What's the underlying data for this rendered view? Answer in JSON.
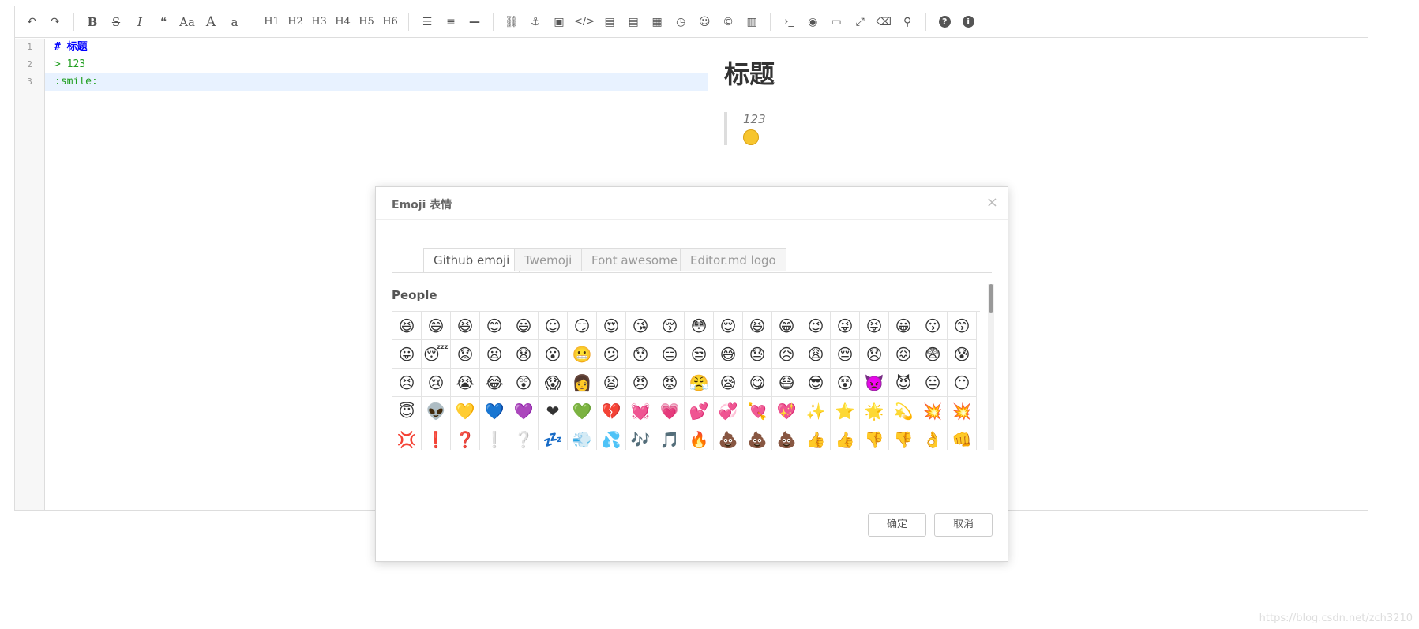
{
  "toolbar": {
    "undo_icon": "undo-icon",
    "redo_icon": "redo-icon",
    "bold": "B",
    "strike": "S",
    "italic": "I",
    "quote": "❝",
    "uppercase": "Aa",
    "ucwords": "A",
    "lowercase": "a",
    "h1": "H1",
    "h2": "H2",
    "h3": "H3",
    "h4": "H4",
    "h5": "H5",
    "h6": "H6",
    "ul": "☰",
    "ol": "≡",
    "hr": "—",
    "link": "⛓",
    "anchor": "⚓",
    "image": "▣",
    "code": "</>",
    "code_block": "▤",
    "code_block2": "▤",
    "table": "▦",
    "datetime": "◷",
    "emoji": "☺",
    "html_entities": "©",
    "pagebreak": "▥",
    "terminal": "›_",
    "watch": "◉",
    "preview": "▭",
    "fullscreen": "⤢",
    "clear": "⌫",
    "search": "⚲",
    "help": "?",
    "info": "i"
  },
  "editor": {
    "line_numbers": [
      "1",
      "2",
      "3"
    ],
    "lines": [
      "# 标题",
      "> 123",
      ":smile:"
    ]
  },
  "preview": {
    "heading": "标题",
    "quote_text": "123"
  },
  "dialog": {
    "title": "Emoji 表情",
    "close": "×",
    "tabs": [
      "Github emoji",
      "Twemoji",
      "Font awesome",
      "Editor.md logo"
    ],
    "section_label": "People",
    "emojis": [
      "😆",
      "😄",
      "😆",
      "😊",
      "😃",
      "☺",
      "😏",
      "😍",
      "😘",
      "😚",
      "😳",
      "😌",
      "😆",
      "😁",
      "😉",
      "😜",
      "😝",
      "😀",
      "😗",
      "😙",
      "😛",
      "😴",
      "😟",
      "😦",
      "😧",
      "😮",
      "😬",
      "😕",
      "😯",
      "😑",
      "😒",
      "😅",
      "😓",
      "😥",
      "😩",
      "😔",
      "😞",
      "😖",
      "😨",
      "😰",
      "😣",
      "😢",
      "😭",
      "😂",
      "😲",
      "😱",
      "👩",
      "😫",
      "😠",
      "😡",
      "😤",
      "😪",
      "😋",
      "😷",
      "😎",
      "😵",
      "👿",
      "😈",
      "😐",
      "😶",
      "😇",
      "👽",
      "💛",
      "💙",
      "💜",
      "❤",
      "💚",
      "💔",
      "💓",
      "💗",
      "💕",
      "💞",
      "💘",
      "💖",
      "✨",
      "⭐",
      "🌟",
      "💫",
      "💥",
      "💥",
      "💢",
      "❗",
      "❓",
      "❕",
      "❔",
      "💤",
      "💨",
      "💦",
      "🎶",
      "🎵",
      "🔥",
      "💩",
      "💩",
      "💩",
      "👍",
      "👍",
      "👎",
      "👎",
      "👌",
      "👊",
      "👊",
      "✊",
      "✌",
      "👋",
      "✋",
      "✋",
      "👐",
      "☝",
      "👇",
      "👈",
      "👉",
      "🙌",
      "🙏",
      "👆",
      "👏",
      "💪",
      "🤘",
      "🖕",
      "🚶",
      "🏃"
    ],
    "ok_label": "确定",
    "cancel_label": "取消"
  },
  "watermark": "https://blog.csdn.net/zch3210"
}
